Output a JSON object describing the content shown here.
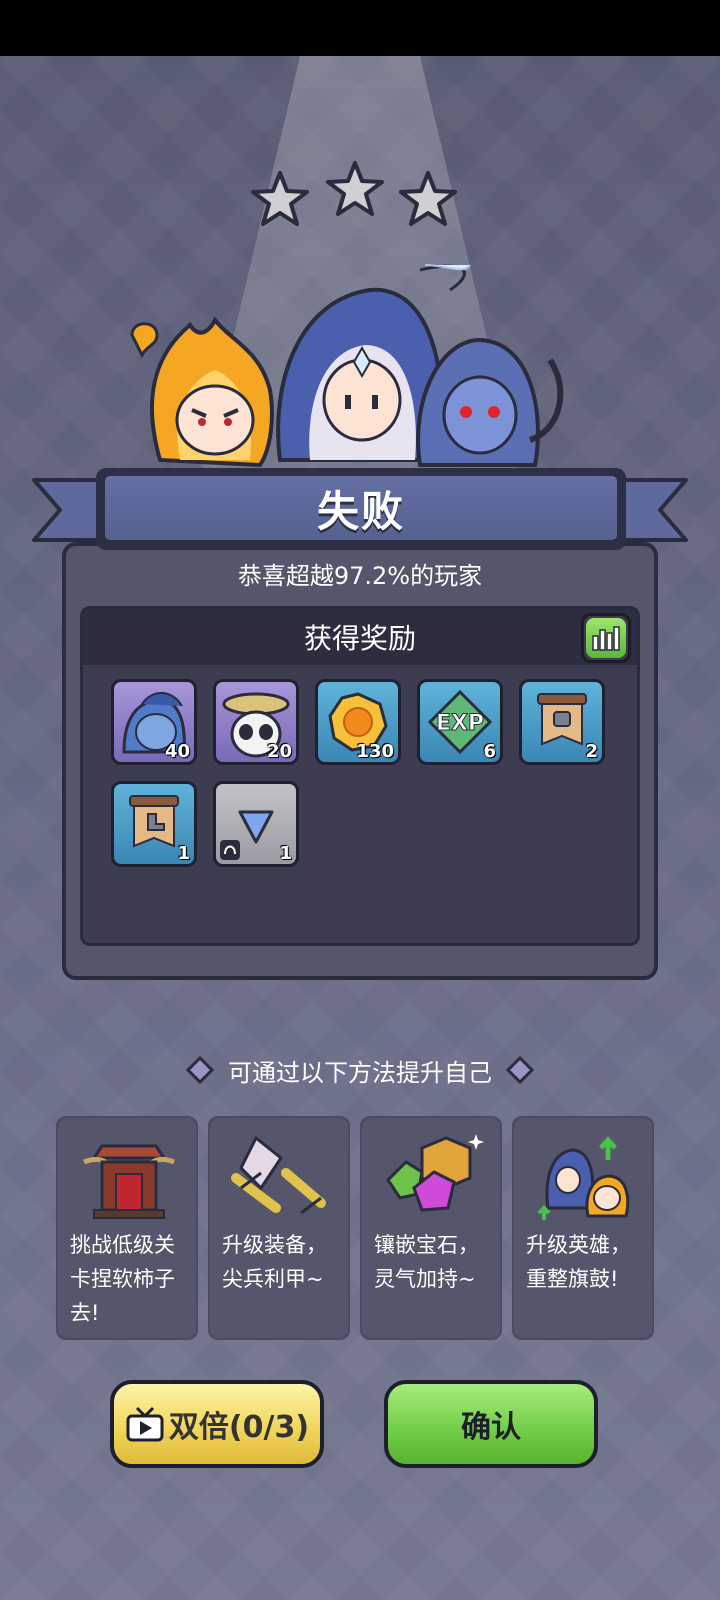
{
  "result": {
    "stars_earned": 0,
    "stars_total": 3,
    "title": "失败",
    "surpass_text": "恭喜超越97.2%的玩家"
  },
  "rewards": {
    "header": "获得奖励",
    "items": [
      {
        "icon": "blue-hero-shard-icon",
        "qty": "40"
      },
      {
        "icon": "panda-hero-shard-icon",
        "qty": "20"
      },
      {
        "icon": "gold-coin-icon",
        "qty": "130"
      },
      {
        "icon": "exp-icon",
        "qty": "6"
      },
      {
        "icon": "armor-scroll-icon",
        "qty": "2"
      },
      {
        "icon": "boots-scroll-icon",
        "qty": "1"
      },
      {
        "icon": "blue-gem-icon",
        "qty": "1"
      }
    ]
  },
  "improve": {
    "title": "可通过以下方法提升自己",
    "tips": [
      {
        "icon": "pagoda-icon",
        "text": "挑战低级关卡捏软柿子去!"
      },
      {
        "icon": "equipment-icon",
        "text": "升级装备，尖兵利甲~"
      },
      {
        "icon": "gems-icon",
        "text": "镶嵌宝石，灵气加持~"
      },
      {
        "icon": "heroes-upgrade-icon",
        "text": "升级英雄，重整旗鼓!"
      }
    ]
  },
  "buttons": {
    "double": "双倍(0/3)",
    "confirm": "确认"
  },
  "colors": {
    "ribbon": "#5e6a9c",
    "panel": "#55556b",
    "confirm_green": "#74cf49",
    "double_yellow": "#f1d75c"
  }
}
